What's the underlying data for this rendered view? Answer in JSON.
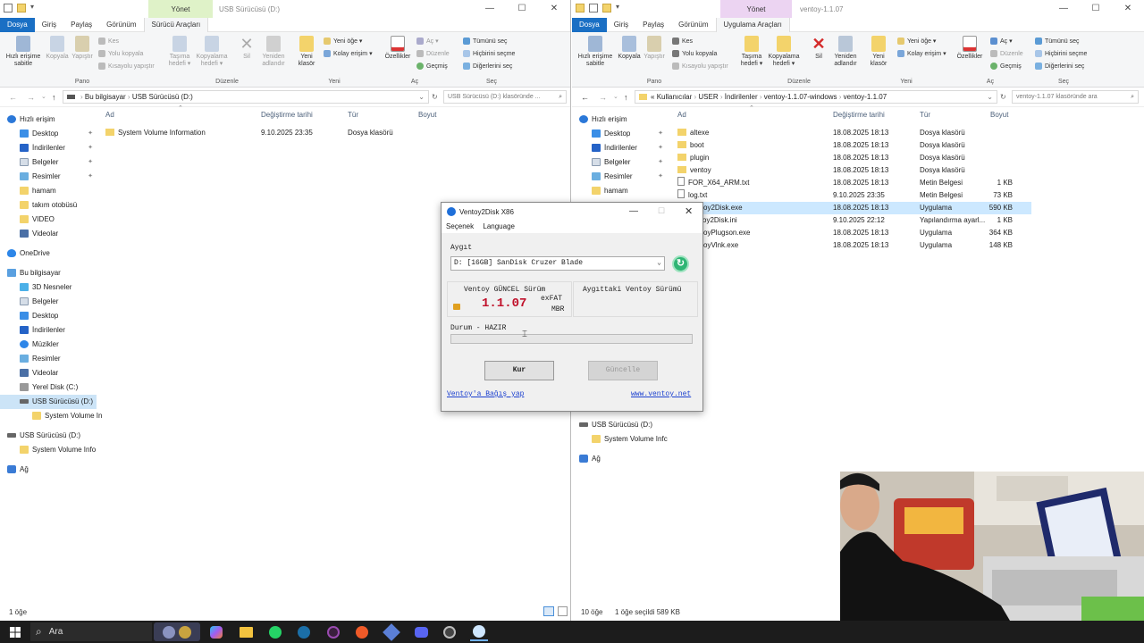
{
  "left": {
    "title": "USB Sürücüsü (D:)",
    "context_tab": "Yönet",
    "tabs": [
      "Dosya",
      "Giriş",
      "Paylaş",
      "Görünüm",
      "Sürücü Araçları"
    ],
    "ribbon": {
      "pin": [
        "Hızlı erişime",
        "sabitle"
      ],
      "copy": "Kopyala",
      "paste": "Yapıştır",
      "cut": "Kes",
      "copy_path": "Yolu kopyala",
      "paste_shortcut": "Kısayolu yapıştır",
      "move_to": [
        "Taşıma",
        "hedefi ▾"
      ],
      "copy_to": [
        "Kopyalama",
        "hedefi ▾"
      ],
      "delete": "Sil",
      "rename": [
        "Yeniden",
        "adlandır"
      ],
      "new_folder": [
        "Yeni",
        "klasör"
      ],
      "new_item": "Yeni öğe ▾",
      "easy_access": "Kolay erişim ▾",
      "properties": "Özellikler",
      "open": "Aç ▾",
      "edit": "Düzenle",
      "history": "Geçmiş",
      "select_all": "Tümünü seç",
      "select_none": "Hiçbirini seçme",
      "invert": "Diğerlerini seç",
      "groups": [
        "Pano",
        "Düzenle",
        "Yeni",
        "Aç",
        "Seç"
      ]
    },
    "address": [
      "Bu bilgisayar",
      "USB Sürücüsü (D:)"
    ],
    "search_placeholder": "USB Sürücüsü (D:) klasöründe ...",
    "columns": [
      "Ad",
      "Değiştirme tarihi",
      "Tür",
      "Boyut"
    ],
    "files": [
      {
        "name": "System Volume Information",
        "date": "9.10.2025 23:35",
        "type": "Dosya klasörü",
        "size": ""
      }
    ],
    "nav": [
      {
        "label": "Hızlı erişim",
        "icon": "star",
        "indent": 0,
        "pin": false
      },
      {
        "label": "Desktop",
        "icon": "desk",
        "indent": 1,
        "pin": true
      },
      {
        "label": "İndirilenler",
        "icon": "dl",
        "indent": 1,
        "pin": true
      },
      {
        "label": "Belgeler",
        "icon": "doc",
        "indent": 1,
        "pin": true
      },
      {
        "label": "Resimler",
        "icon": "pic",
        "indent": 1,
        "pin": true
      },
      {
        "label": "hamam",
        "icon": "fold",
        "indent": 1,
        "pin": false
      },
      {
        "label": "takım otobüsü",
        "icon": "fold",
        "indent": 1,
        "pin": false
      },
      {
        "label": "VIDEO",
        "icon": "fold",
        "indent": 1,
        "pin": false
      },
      {
        "label": "Videolar",
        "icon": "vid",
        "indent": 1,
        "pin": false
      },
      {
        "label": "",
        "icon": "",
        "indent": 0,
        "pin": false,
        "gap": true
      },
      {
        "label": "OneDrive",
        "icon": "cloud",
        "indent": 0,
        "pin": false
      },
      {
        "label": "",
        "icon": "",
        "indent": 0,
        "pin": false,
        "gap": true
      },
      {
        "label": "Bu bilgisayar",
        "icon": "pc",
        "indent": 0,
        "pin": false
      },
      {
        "label": "3D Nesneler",
        "icon": "cube",
        "indent": 1,
        "pin": false
      },
      {
        "label": "Belgeler",
        "icon": "doc",
        "indent": 1,
        "pin": false
      },
      {
        "label": "Desktop",
        "icon": "desk",
        "indent": 1,
        "pin": false
      },
      {
        "label": "İndirilenler",
        "icon": "dl",
        "indent": 1,
        "pin": false
      },
      {
        "label": "Müzikler",
        "icon": "mus",
        "indent": 1,
        "pin": false
      },
      {
        "label": "Resimler",
        "icon": "pic",
        "indent": 1,
        "pin": false
      },
      {
        "label": "Videolar",
        "icon": "vid",
        "indent": 1,
        "pin": false
      },
      {
        "label": "Yerel Disk (C:)",
        "icon": "disk",
        "indent": 1,
        "pin": false
      },
      {
        "label": "USB Sürücüsü (D:)",
        "icon": "usb",
        "indent": 1,
        "pin": false,
        "selected": true
      },
      {
        "label": "System Volume In",
        "icon": "fold",
        "indent": 2,
        "pin": false
      },
      {
        "label": "",
        "icon": "",
        "indent": 0,
        "pin": false,
        "gap": true
      },
      {
        "label": "USB Sürücüsü (D:)",
        "icon": "usb",
        "indent": 0,
        "pin": false
      },
      {
        "label": "System Volume Info",
        "icon": "fold",
        "indent": 1,
        "pin": false
      },
      {
        "label": "",
        "icon": "",
        "indent": 0,
        "pin": false,
        "gap": true
      },
      {
        "label": "Ağ",
        "icon": "net",
        "indent": 0,
        "pin": false
      }
    ],
    "status": "1 öğe"
  },
  "right": {
    "title": "ventoy-1.1.07",
    "context_tab": "Yönet",
    "tabs": [
      "Dosya",
      "Giriş",
      "Paylaş",
      "Görünüm",
      "Uygulama Araçları"
    ],
    "ribbon": {
      "pin": [
        "Hızlı erişime",
        "sabitle"
      ],
      "copy": "Kopyala",
      "paste": "Yapıştır",
      "cut": "Kes",
      "copy_path": "Yolu kopyala",
      "paste_shortcut": "Kısayolu yapıştır",
      "move_to": [
        "Taşıma",
        "hedefi ▾"
      ],
      "copy_to": [
        "Kopyalama",
        "hedefi ▾"
      ],
      "delete": "Sil",
      "rename": [
        "Yeniden",
        "adlandır"
      ],
      "new_folder": [
        "Yeni",
        "klasör"
      ],
      "new_item": "Yeni öğe ▾",
      "easy_access": "Kolay erişim ▾",
      "properties": "Özellikler",
      "open": "Aç ▾",
      "edit": "Düzenle",
      "history": "Geçmiş",
      "select_all": "Tümünü seç",
      "select_none": "Hiçbirini seçme",
      "invert": "Diğerlerini seç",
      "groups": [
        "Pano",
        "Düzenle",
        "Yeni",
        "Aç",
        "Seç"
      ]
    },
    "address": [
      "«",
      "Kullanıcılar",
      "USER",
      "İndirilenler",
      "ventoy-1.1.07-windows",
      "ventoy-1.1.07"
    ],
    "search_placeholder": "ventoy-1.1.07 klasöründe ara",
    "columns": [
      "Ad",
      "Değiştirme tarihi",
      "Tür",
      "Boyut"
    ],
    "files": [
      {
        "name": "altexe",
        "date": "18.08.2025 18:13",
        "type": "Dosya klasörü",
        "size": "",
        "icon": "fold"
      },
      {
        "name": "boot",
        "date": "18.08.2025 18:13",
        "type": "Dosya klasörü",
        "size": "",
        "icon": "fold"
      },
      {
        "name": "plugin",
        "date": "18.08.2025 18:13",
        "type": "Dosya klasörü",
        "size": "",
        "icon": "fold"
      },
      {
        "name": "ventoy",
        "date": "18.08.2025 18:13",
        "type": "Dosya klasörü",
        "size": "",
        "icon": "fold"
      },
      {
        "name": "FOR_X64_ARM.txt",
        "date": "18.08.2025 18:13",
        "type": "Metin Belgesi",
        "size": "1 KB",
        "icon": "txt"
      },
      {
        "name": "log.txt",
        "date": "9.10.2025 23:35",
        "type": "Metin Belgesi",
        "size": "73 KB",
        "icon": "txt"
      },
      {
        "name": "Ventoy2Disk.exe",
        "date": "18.08.2025 18:13",
        "type": "Uygulama",
        "size": "590 KB",
        "icon": "exe",
        "selected": true
      },
      {
        "name": "Ventoy2Disk.ini",
        "date": "9.10.2025 22:12",
        "type": "Yapılandırma ayarl...",
        "size": "1 KB",
        "icon": "txt"
      },
      {
        "name": "VentoyPlugson.exe",
        "date": "18.08.2025 18:13",
        "type": "Uygulama",
        "size": "364 KB",
        "icon": "exe"
      },
      {
        "name": "VentoyVlnk.exe",
        "date": "18.08.2025 18:13",
        "type": "Uygulama",
        "size": "148 KB",
        "icon": "exe"
      }
    ],
    "nav": [
      {
        "label": "Hızlı erişim",
        "icon": "star",
        "indent": 0,
        "pin": false
      },
      {
        "label": "Desktop",
        "icon": "desk",
        "indent": 1,
        "pin": true
      },
      {
        "label": "İndirilenler",
        "icon": "dl",
        "indent": 1,
        "pin": true
      },
      {
        "label": "Belgeler",
        "icon": "doc",
        "indent": 1,
        "pin": true
      },
      {
        "label": "Resimler",
        "icon": "pic",
        "indent": 1,
        "pin": true
      },
      {
        "label": "hamam",
        "icon": "fold",
        "indent": 1,
        "pin": false
      }
    ],
    "nav_bottom": [
      {
        "label": "USB Sürücüsü (D:)",
        "icon": "usb",
        "indent": 0
      },
      {
        "label": "System Volume Infc",
        "icon": "fold",
        "indent": 1
      },
      {
        "label": "",
        "icon": "",
        "indent": 0,
        "gap": true
      },
      {
        "label": "Ağ",
        "icon": "net",
        "indent": 0
      }
    ],
    "status_count": "10 öğe",
    "status_selected": "1 öğe seçildi  589 KB"
  },
  "ventoy": {
    "title": "Ventoy2Disk  X86",
    "menu": [
      "Seçenek",
      "Language"
    ],
    "device_label": "Aygıt",
    "device_value": "D: [16GB] SanDisk Cruzer Blade",
    "current_version_label": "Ventoy GÜNCEL Sürüm",
    "device_version_label": "Aygıttaki Ventoy Sürümü",
    "version": "1.1.07",
    "fs": "exFAT",
    "part": "MBR",
    "status": "Durum - HAZIR",
    "progress": 0,
    "install_button": "Kur",
    "update_button": "Güncelle",
    "donate_link": "Ventoy'a Bağış yap",
    "site_link": "www.ventoy.net",
    "version_color": "#c0102a",
    "link_color": "#1a3fcf"
  },
  "taskbar": {
    "search": "Ara"
  }
}
